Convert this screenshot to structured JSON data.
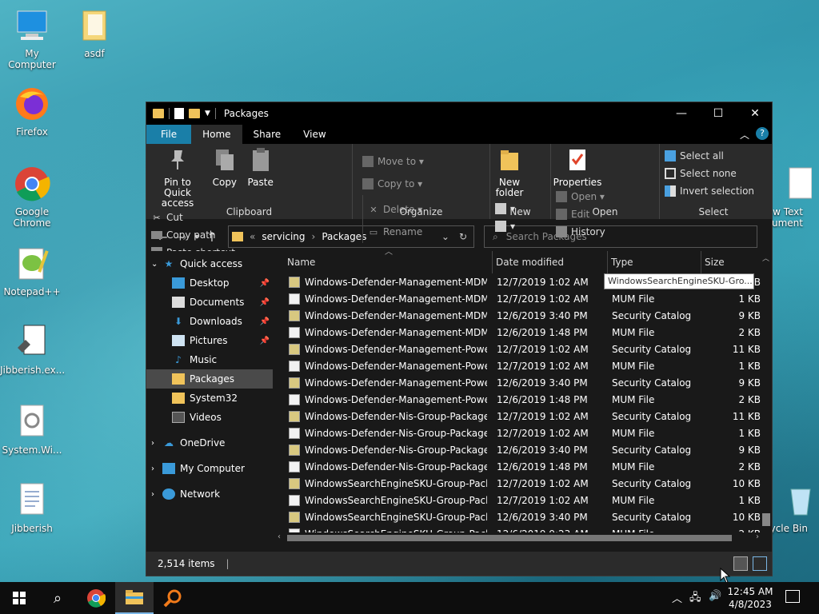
{
  "desktop": {
    "icons": [
      "My Computer",
      "asdf",
      "Firefox",
      "Google\nChrome",
      "Notepad++",
      "Jibberish.ex...",
      "System.Wi...",
      "Jibberish",
      "w Text\ncument",
      "cycle Bin"
    ]
  },
  "window": {
    "title": "Packages",
    "tabs": [
      "File",
      "Home",
      "Share",
      "View"
    ],
    "ribbon": {
      "clipboard": {
        "pin": "Pin to Quick access",
        "copy": "Copy",
        "paste": "Paste",
        "cut": "Cut",
        "copy_path": "Copy path",
        "paste_shortcut": "Paste shortcut",
        "label": "Clipboard"
      },
      "organize": {
        "move_to": "Move to",
        "copy_to": "Copy to",
        "delete": "Delete",
        "rename": "Rename",
        "label": "Organize"
      },
      "new": {
        "new_folder": "New folder",
        "label": "New"
      },
      "open": {
        "properties": "Properties",
        "open": "Open",
        "edit": "Edit",
        "history": "History",
        "label": "Open"
      },
      "select": {
        "select_all": "Select all",
        "select_none": "Select none",
        "invert": "Invert selection",
        "label": "Select"
      }
    },
    "address": {
      "crumbs": [
        "«",
        "servicing",
        "Packages"
      ]
    },
    "search": {
      "placeholder": "Search Packages"
    },
    "nav": {
      "quick_access": "Quick access",
      "items": [
        "Desktop",
        "Documents",
        "Downloads",
        "Pictures",
        "Music",
        "Packages",
        "System32",
        "Videos"
      ],
      "onedrive": "OneDrive",
      "my_computer": "My Computer",
      "network": "Network"
    },
    "columns": [
      "Name",
      "Date modified",
      "Type",
      "Size"
    ],
    "files": [
      {
        "name": "Windows-Defender-Management-MDM...",
        "date": "12/7/2019 1:02 AM",
        "type": "",
        "size": "KB",
        "cat": true
      },
      {
        "name": "Windows-Defender-Management-MDM...",
        "date": "12/7/2019 1:02 AM",
        "type": "MUM File",
        "size": "1 KB",
        "cat": false
      },
      {
        "name": "Windows-Defender-Management-MDM...",
        "date": "12/6/2019 3:40 PM",
        "type": "Security Catalog",
        "size": "9 KB",
        "cat": true
      },
      {
        "name": "Windows-Defender-Management-MDM...",
        "date": "12/6/2019 1:48 PM",
        "type": "MUM File",
        "size": "2 KB",
        "cat": false
      },
      {
        "name": "Windows-Defender-Management-Power...",
        "date": "12/7/2019 1:02 AM",
        "type": "Security Catalog",
        "size": "11 KB",
        "cat": true
      },
      {
        "name": "Windows-Defender-Management-Power...",
        "date": "12/7/2019 1:02 AM",
        "type": "MUM File",
        "size": "1 KB",
        "cat": false
      },
      {
        "name": "Windows-Defender-Management-Power...",
        "date": "12/6/2019 3:40 PM",
        "type": "Security Catalog",
        "size": "9 KB",
        "cat": true
      },
      {
        "name": "Windows-Defender-Management-Power...",
        "date": "12/6/2019 1:48 PM",
        "type": "MUM File",
        "size": "2 KB",
        "cat": false
      },
      {
        "name": "Windows-Defender-Nis-Group-Package...",
        "date": "12/7/2019 1:02 AM",
        "type": "Security Catalog",
        "size": "11 KB",
        "cat": true
      },
      {
        "name": "Windows-Defender-Nis-Group-Package...",
        "date": "12/7/2019 1:02 AM",
        "type": "MUM File",
        "size": "1 KB",
        "cat": false
      },
      {
        "name": "Windows-Defender-Nis-Group-Package...",
        "date": "12/6/2019 3:40 PM",
        "type": "Security Catalog",
        "size": "9 KB",
        "cat": true
      },
      {
        "name": "Windows-Defender-Nis-Group-Package...",
        "date": "12/6/2019 1:48 PM",
        "type": "MUM File",
        "size": "2 KB",
        "cat": false
      },
      {
        "name": "WindowsSearchEngineSKU-Group-Packa...",
        "date": "12/7/2019 1:02 AM",
        "type": "Security Catalog",
        "size": "10 KB",
        "cat": true
      },
      {
        "name": "WindowsSearchEngineSKU-Group-Packa...",
        "date": "12/7/2019 1:02 AM",
        "type": "MUM File",
        "size": "1 KB",
        "cat": false
      },
      {
        "name": "WindowsSearchEngineSKU-Group-Packa...",
        "date": "12/6/2019 3:40 PM",
        "type": "Security Catalog",
        "size": "10 KB",
        "cat": true
      },
      {
        "name": "WindowsSearchEngineSKU-Group-Packa...",
        "date": "12/6/2019 9:23 AM",
        "type": "MUM File",
        "size": "2 KB",
        "cat": false
      }
    ],
    "tooltip": "WindowsSearchEngineSKU-Gro...",
    "status": "2,514 items"
  },
  "taskbar": {
    "time": "12:45 AM",
    "date": "4/8/2023"
  }
}
